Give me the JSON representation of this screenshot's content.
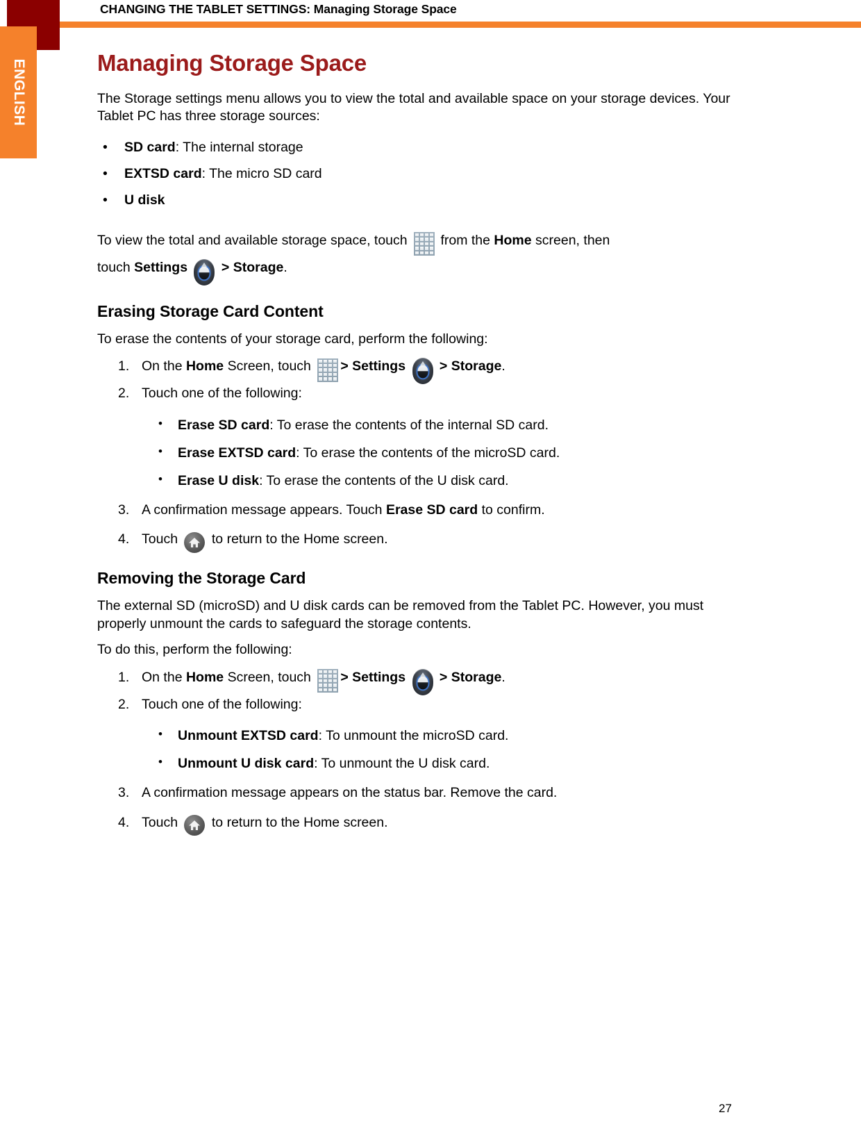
{
  "header": {
    "title": "CHANGING THE TABLET SETTINGS: Managing Storage Space",
    "rule_color": "#F5812B",
    "block_color": "#8B0000"
  },
  "sidebar": {
    "language_tab": "ENGLISH",
    "tab_color": "#F5812B"
  },
  "page_number": "27",
  "main": {
    "title": "Managing Storage Space",
    "title_color": "#9B1B1B",
    "intro": "The Storage settings menu allows you to view the total and available space on your storage devices. Your Tablet PC has three storage sources:",
    "sources": [
      {
        "term": "SD card",
        "desc": ": The internal storage"
      },
      {
        "term": "EXTSD card",
        "desc": ": The micro SD card"
      },
      {
        "term": "U disk",
        "desc": ""
      }
    ],
    "view_instruction": {
      "part1": "To view the total and available storage space, touch",
      "part2": "from the",
      "home_bold": "Home",
      "part3": "screen, then",
      "part4": "touch",
      "settings_bold": "Settings",
      "chevron": ">",
      "storage_bold": "Storage",
      "period": "."
    },
    "sections": [
      {
        "heading": "Erasing Storage Card Content",
        "lead": "To erase the contents of your storage card, perform the following:",
        "steps": [
          {
            "num": "1.",
            "pre": "On the",
            "home_bold": "Home",
            "mid": "Screen, touch",
            "chevron1": ">",
            "settings_bold": "Settings",
            "chevron2": ">",
            "storage_bold": "Storage",
            "period": "."
          },
          {
            "num": "2.",
            "text": "Touch one of the following:"
          },
          {
            "num": "3.",
            "pre": "A confirmation message appears. Touch",
            "bold": "Erase SD card",
            "post": "to confirm."
          },
          {
            "num": "4.",
            "pre": "Touch",
            "post": "to return to the Home screen."
          }
        ],
        "options": [
          {
            "term": "Erase SD card",
            "desc": ": To erase the contents of the internal SD card."
          },
          {
            "term": "Erase EXTSD card",
            "desc": ": To erase the contents of the microSD card."
          },
          {
            "term": "Erase U disk",
            "desc": ": To erase the contents of the U disk card."
          }
        ]
      },
      {
        "heading": "Removing the Storage Card",
        "lead": "The external SD (microSD) and U disk cards can be removed from the Tablet PC. However, you must properly unmount the cards to safeguard the storage contents.",
        "lead2": "To do this, perform the following:",
        "steps": [
          {
            "num": "1.",
            "pre": "On the",
            "home_bold": "Home",
            "mid": "Screen, touch",
            "chevron1": ">",
            "settings_bold": "Settings",
            "chevron2": ">",
            "storage_bold": "Storage",
            "period": "."
          },
          {
            "num": "2.",
            "text": "Touch one of the following:"
          },
          {
            "num": "3.",
            "text": "A confirmation message appears on the status bar. Remove the card."
          },
          {
            "num": "4.",
            "pre": "Touch",
            "post": "to return to the Home screen."
          }
        ],
        "options": [
          {
            "term": "Unmount EXTSD card",
            "desc": ": To unmount the microSD card."
          },
          {
            "term": "Unmount U disk card",
            "desc": ": To unmount the U disk card."
          }
        ]
      }
    ]
  },
  "icons": {
    "grid": "apps-grid-icon",
    "settings": "settings-gear-icon",
    "home": "home-icon"
  }
}
